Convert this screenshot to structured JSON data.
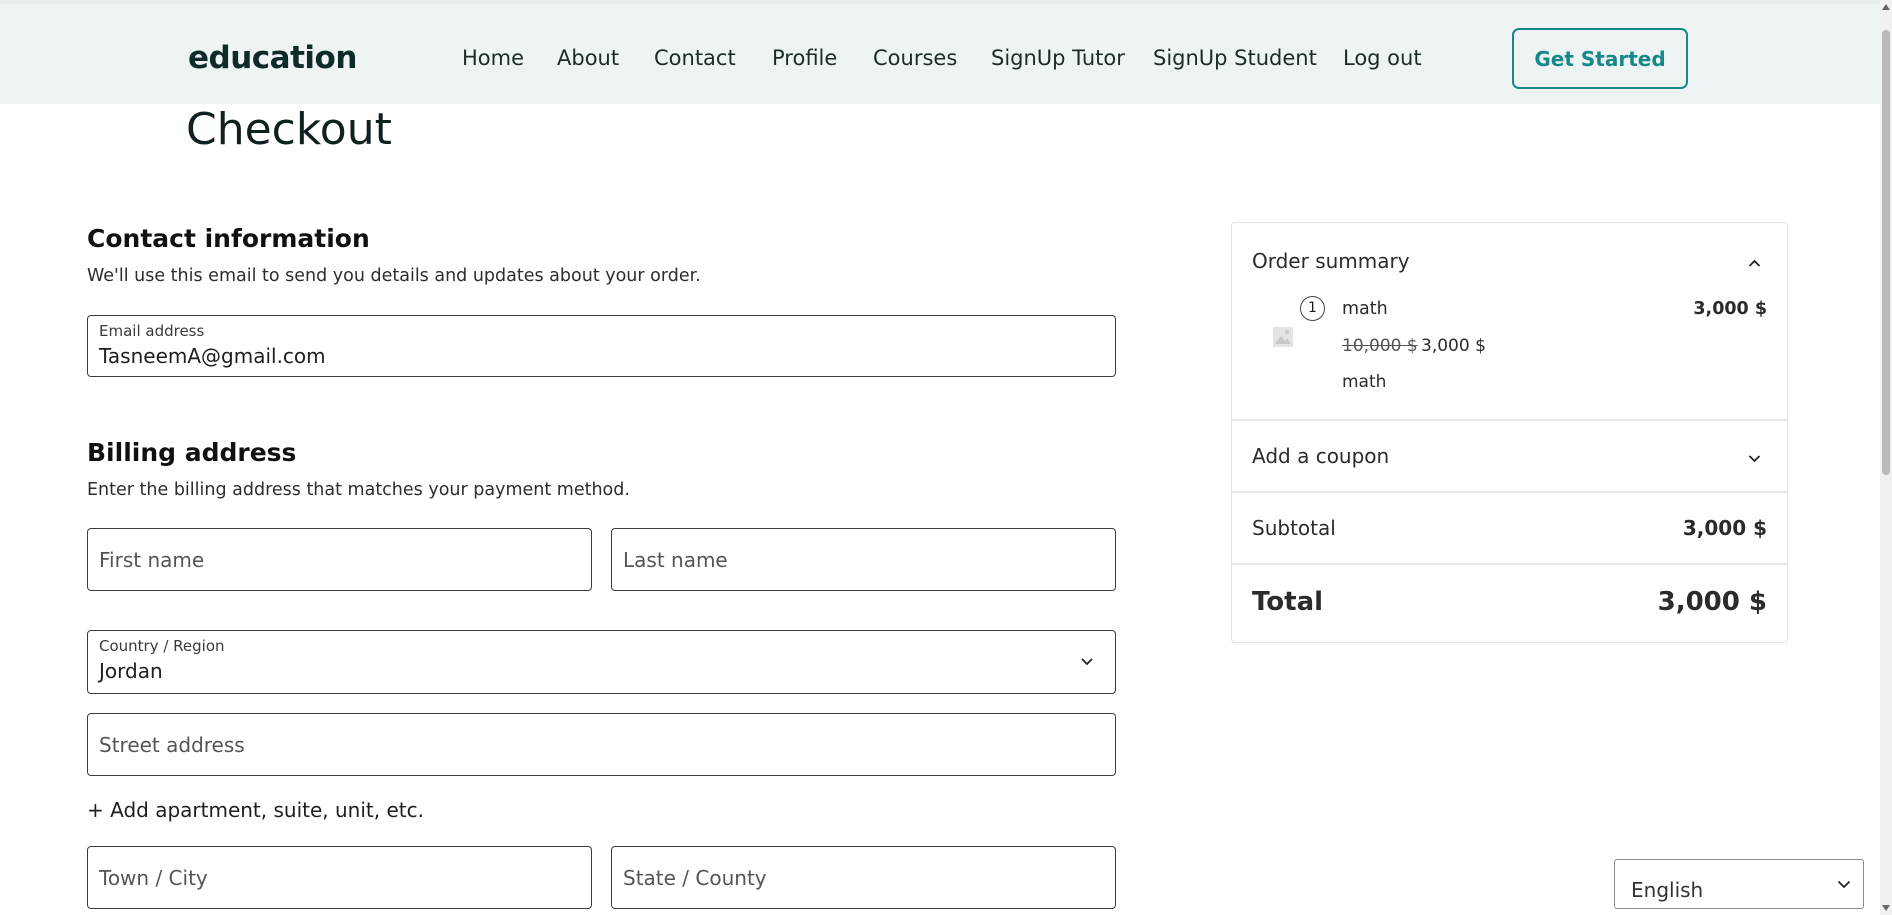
{
  "header": {
    "logo": "education",
    "nav": [
      "Home",
      "About",
      "Contact",
      "Profile",
      "Courses",
      "SignUp Tutor",
      "SignUp Student",
      "Log out"
    ],
    "cta_label": "Get Started",
    "accent_color": "#16888a"
  },
  "page": {
    "title": "Checkout"
  },
  "contact": {
    "title": "Contact information",
    "description": "We'll use this email to send you details and updates about your order.",
    "email_label": "Email address",
    "email_value": "TasneemA@gmail.com"
  },
  "billing": {
    "title": "Billing address",
    "description": "Enter the billing address that matches your payment method.",
    "first_name_placeholder": "First name",
    "last_name_placeholder": "Last name",
    "country_label": "Country / Region",
    "country_value": "Jordan",
    "street_placeholder": "Street address",
    "add_apartment": "+ Add apartment, suite, unit, etc.",
    "city_placeholder": "Town / City",
    "state_placeholder": "State / County"
  },
  "summary": {
    "title": "Order summary",
    "item": {
      "quantity": "1",
      "name": "math",
      "price": "3,000 $",
      "original_price": "10,000 $",
      "sale_price": "3,000 $",
      "description": "math"
    },
    "coupon_label": "Add a coupon",
    "subtotal_label": "Subtotal",
    "subtotal_value": "3,000 $",
    "total_label": "Total",
    "total_value": "3,000 $"
  },
  "language": {
    "selected": "English"
  },
  "icons": {
    "summary_toggle": "chevron-up-icon",
    "coupon_toggle": "chevron-down-icon",
    "country_toggle": "chevron-down-icon",
    "language_toggle": "chevron-down-icon",
    "item_image": "image-placeholder-icon"
  }
}
